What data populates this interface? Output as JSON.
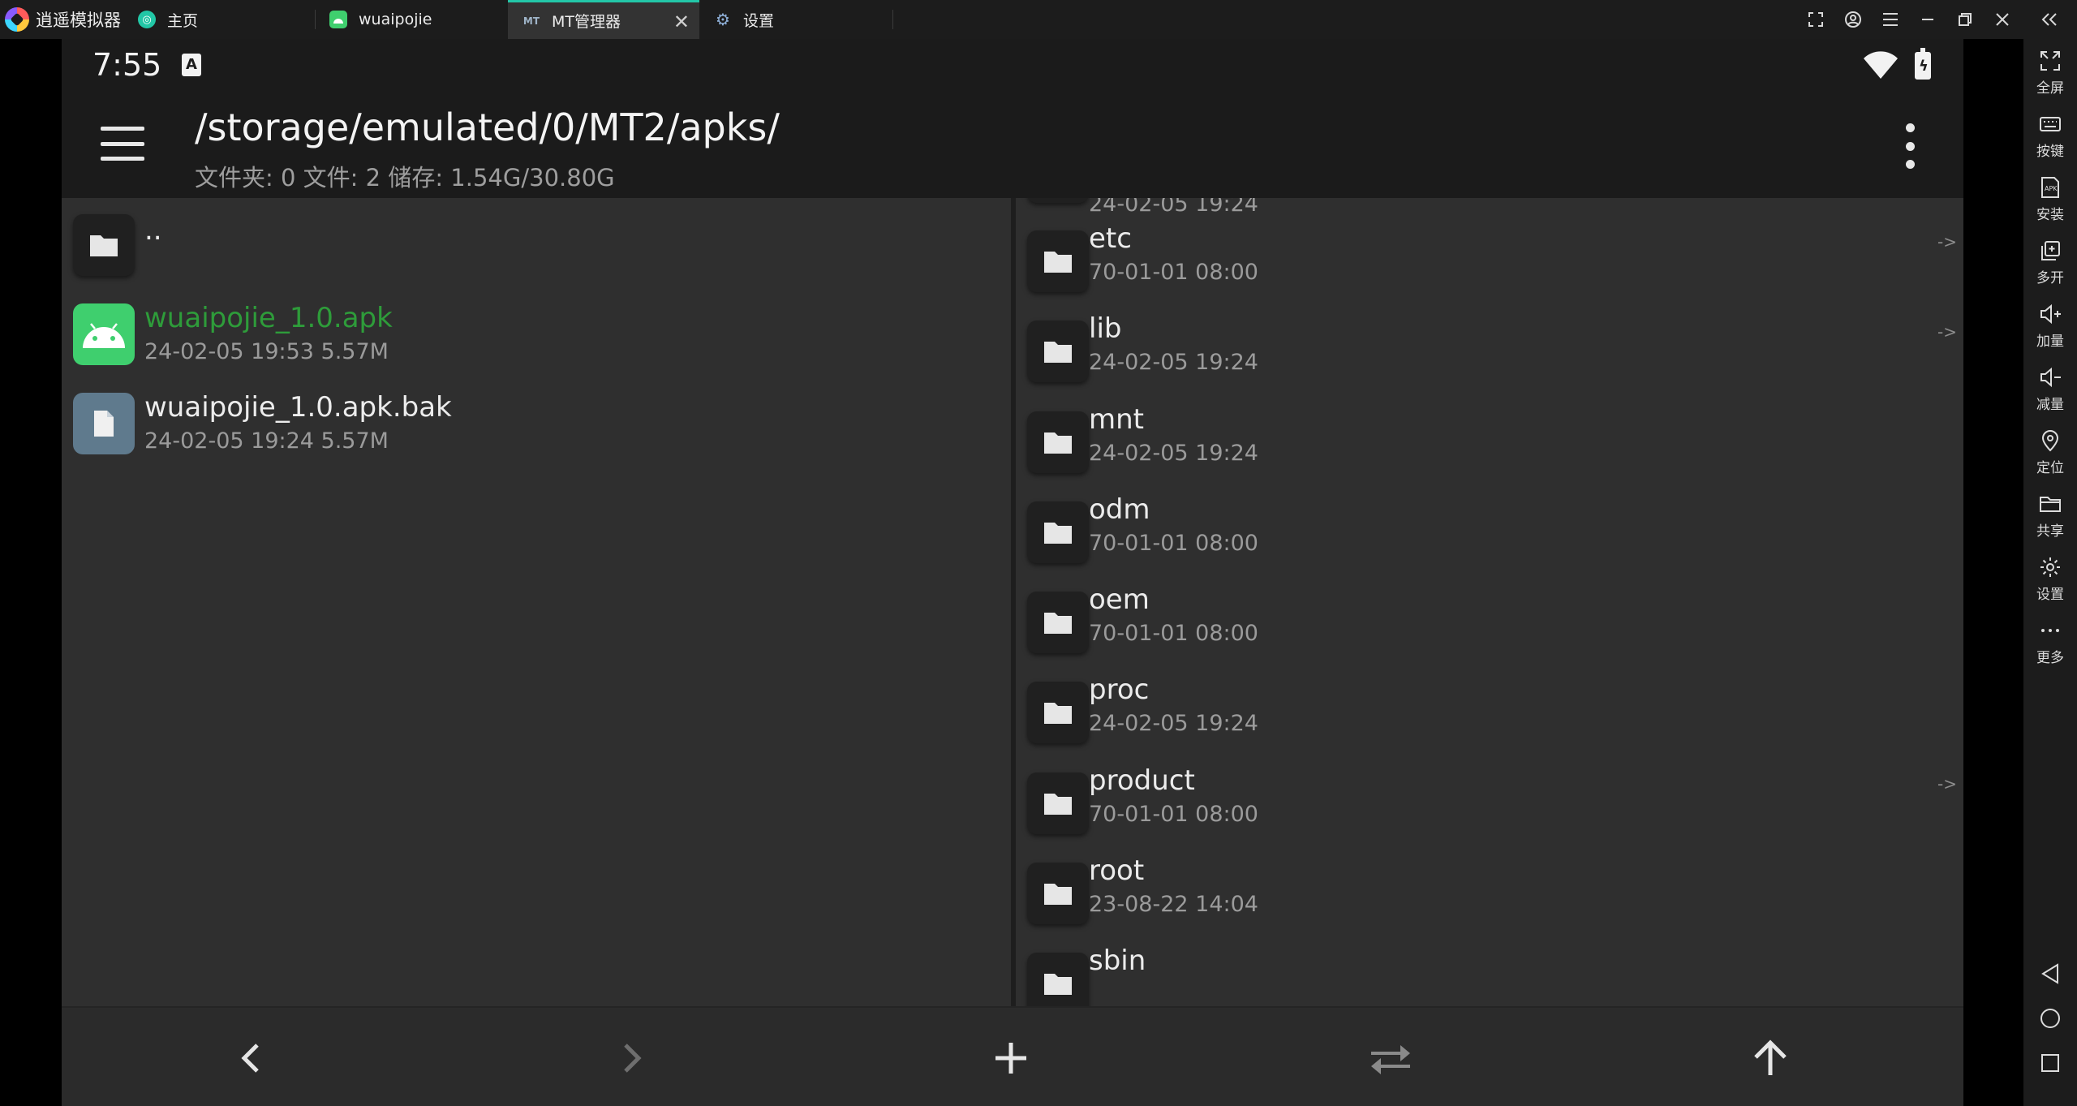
{
  "emulator": {
    "brand": "逍遥模拟器",
    "tabs": [
      {
        "label": "主页",
        "icon": "home-icon"
      },
      {
        "label": "wuaipojie",
        "icon": "android-app-icon"
      },
      {
        "label": "MT管理器",
        "icon": "mt-manager-icon",
        "active": true
      },
      {
        "label": "设置",
        "icon": "settings-gear-icon"
      }
    ],
    "window_controls": [
      "screenshot-icon",
      "account-icon",
      "menu-icon",
      "minimize-icon",
      "restore-icon",
      "close-icon",
      "collapse-icon"
    ],
    "sidebar": [
      {
        "label": "全屏",
        "icon": "fullscreen-icon"
      },
      {
        "label": "按键",
        "icon": "keyboard-icon"
      },
      {
        "label": "安装",
        "icon": "apk-install-icon"
      },
      {
        "label": "多开",
        "icon": "multi-instance-icon"
      },
      {
        "label": "加量",
        "icon": "volume-up-icon"
      },
      {
        "label": "减量",
        "icon": "volume-down-icon"
      },
      {
        "label": "定位",
        "icon": "location-icon"
      },
      {
        "label": "共享",
        "icon": "shared-folder-icon"
      },
      {
        "label": "设置",
        "icon": "settings-icon"
      },
      {
        "label": "更多",
        "icon": "more-icon"
      }
    ],
    "nav": [
      "back-triangle-icon",
      "home-circle-icon",
      "recents-square-icon"
    ]
  },
  "android": {
    "time": "7:55",
    "notif_icon_letter": "A"
  },
  "appbar": {
    "path": "/storage/emulated/0/MT2/apks/",
    "info": "文件夹: 0  文件: 2  储存: 1.54G/30.80G"
  },
  "left_pane": {
    "parent": "..",
    "files": [
      {
        "name": "wuaipojie_1.0.apk",
        "meta": "24-02-05 19:53  5.57M",
        "type": "apk"
      },
      {
        "name": "wuaipojie_1.0.apk.bak",
        "meta": "24-02-05 19:24  5.57M",
        "type": "file"
      }
    ]
  },
  "right_pane": {
    "partial_top_meta": "24-02-05 19:24",
    "folders": [
      {
        "name": "etc",
        "meta": "70-01-01 08:00",
        "link": "->"
      },
      {
        "name": "lib",
        "meta": "24-02-05 19:24",
        "link": "->"
      },
      {
        "name": "mnt",
        "meta": "24-02-05 19:24",
        "link": ""
      },
      {
        "name": "odm",
        "meta": "70-01-01 08:00",
        "link": ""
      },
      {
        "name": "oem",
        "meta": "70-01-01 08:00",
        "link": ""
      },
      {
        "name": "proc",
        "meta": "24-02-05 19:24",
        "link": ""
      },
      {
        "name": "product",
        "meta": "70-01-01 08:00",
        "link": "->"
      },
      {
        "name": "root",
        "meta": "23-08-22 14:04",
        "link": ""
      },
      {
        "name": "sbin",
        "meta": "",
        "link": ""
      }
    ]
  },
  "bottombar": [
    "back-arrow-icon",
    "forward-arrow-icon",
    "add-icon",
    "swap-icon",
    "up-arrow-icon"
  ]
}
